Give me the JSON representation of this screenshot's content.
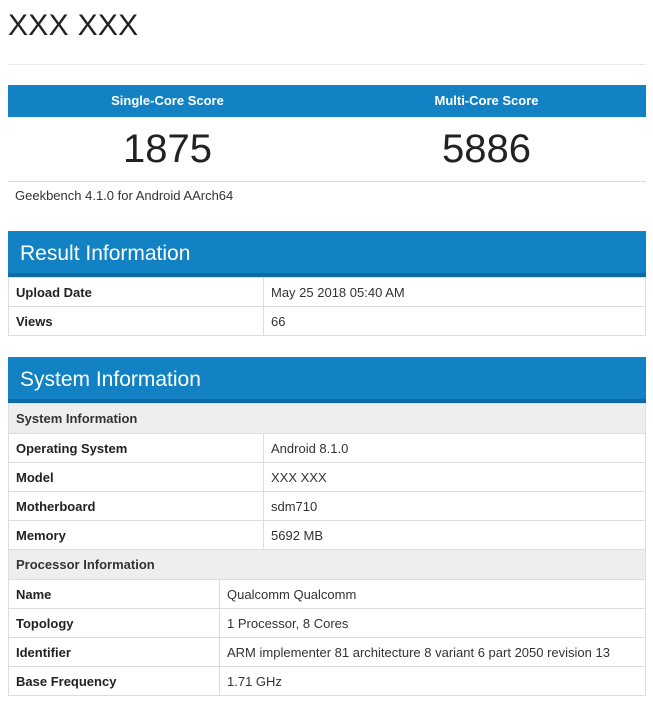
{
  "header": {
    "title": "XXX XXX"
  },
  "scores": {
    "single_core_label": "Single-Core Score",
    "multi_core_label": "Multi-Core Score",
    "single_core_value": "1875",
    "multi_core_value": "5886"
  },
  "version": "Geekbench 4.1.0 for Android AArch64",
  "result_information": {
    "title": "Result Information",
    "rows": [
      {
        "key": "Upload Date",
        "value": "May 25 2018 05:40 AM"
      },
      {
        "key": "Views",
        "value": "66"
      }
    ]
  },
  "system_information": {
    "title": "System Information",
    "system_subheader": "System Information",
    "system_rows": [
      {
        "key": "Operating System",
        "value": "Android 8.1.0"
      },
      {
        "key": "Model",
        "value": "XXX XXX"
      },
      {
        "key": "Motherboard",
        "value": "sdm710"
      },
      {
        "key": "Memory",
        "value": "5692 MB"
      }
    ],
    "processor_subheader": "Processor Information",
    "processor_rows": [
      {
        "key": "Name",
        "value": "Qualcomm Qualcomm"
      },
      {
        "key": "Topology",
        "value": "1 Processor, 8 Cores"
      },
      {
        "key": "Identifier",
        "value": "ARM implementer 81 architecture 8 variant 6 part 2050 revision 13"
      },
      {
        "key": "Base Frequency",
        "value": "1.71 GHz"
      }
    ]
  },
  "colors": {
    "accent_blue": "#1282c4",
    "subheader_gray": "#eeeeee",
    "border_gray": "#dddddd"
  }
}
